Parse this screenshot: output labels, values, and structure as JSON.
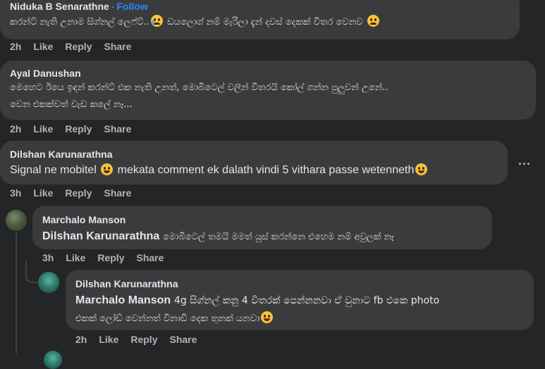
{
  "comments": [
    {
      "author": "Niduka B Senarathne",
      "follow": "Follow",
      "text": "කරන්ට් නැති උනාම සිග්නල් ලෙෆ්ට්..",
      "text_tail": " ඩයලොග් නම් මැරිලා දැන් දවස් දෙකක් විතර වෙනව",
      "time": "2h",
      "like": "Like",
      "reply": "Reply",
      "share": "Share"
    },
    {
      "author": "Ayal Danushan",
      "text_line1": "මෙහෙට ඊයෙ ඉඳන් කරන්ට් එක නැති උනත්, මොබිටෙල් වලින් විතරයි කෝල් ගන්න පුලුවන් උනේ..",
      "text_line2": "වෙන එකක්වත් වැඩ කලේ නෑ...",
      "time": "2h",
      "like": "Like",
      "reply": "Reply",
      "share": "Share"
    },
    {
      "author": "Dilshan Karunarathna",
      "text_a": "Signal ne mobitel",
      "text_b": "mekata comment ek dalath vindi 5 vithara passe wetenneth",
      "time": "3h",
      "like": "Like",
      "reply": "Reply",
      "share": "Share",
      "more": "..."
    }
  ],
  "replies": [
    {
      "author": "Marchalo Manson",
      "mention": "Dilshan Karunarathna",
      "text": "මොබිටෙල් තමයි මමත් යූස් කරන්නෙ එහෙම නම් අවුලක් නෑ",
      "time": "3h",
      "like": "Like",
      "reply": "Reply",
      "share": "Share"
    },
    {
      "author": "Dilshan Karunarathna",
      "mention": "Marchalo Manson",
      "text_line1": "4g සිග්නල් කනු 4 විතරක් පෙන්නනවා ඒ වුනාට fb එකෙ photo",
      "text_line2": "එකක් ලෝඩ් වෙන්නත් විනාඩි දෙක තුනක් යනවා",
      "time": "2h",
      "like": "Like",
      "reply": "Reply",
      "share": "Share"
    }
  ]
}
